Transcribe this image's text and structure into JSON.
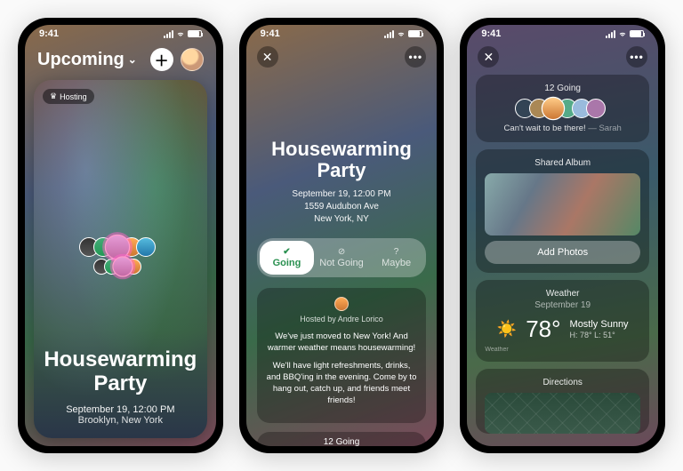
{
  "status": {
    "time": "9:41"
  },
  "screen1": {
    "filter_title": "Upcoming",
    "card": {
      "badge_label": "Hosting",
      "event_title": "Housewarming Party",
      "date_line": "September 19, 12:00 PM",
      "location_line": "Brooklyn, New York"
    }
  },
  "screen2": {
    "event_title": "Housewarming Party",
    "date_line": "September 19, 12:00 PM",
    "address_line": "1559 Audubon Ave",
    "city_line": "New York, NY",
    "rsvp": {
      "going": "Going",
      "not_going": "Not Going",
      "maybe": "Maybe"
    },
    "host_line": "Hosted by Andre Lorico",
    "desc_p1": "We've just moved to New York! And warmer weather means housewarming!",
    "desc_p2": "We'll have light refreshments, drinks, and BBQ'ing in the evening. Come by to hang out, catch up, and friends meet friends!",
    "going_count_label": "12 Going"
  },
  "screen3": {
    "going_card": {
      "head": "12 Going",
      "quote_text": "Can't wait to be there!",
      "quote_who": "— Sarah"
    },
    "album": {
      "head": "Shared Album",
      "button": "Add Photos"
    },
    "weather": {
      "head": "Weather",
      "date": "September 19",
      "temp": "78°",
      "summary": "Mostly Sunny",
      "hilo": "H: 78° L: 51°",
      "source": "Weather"
    },
    "directions": {
      "head": "Directions"
    }
  }
}
